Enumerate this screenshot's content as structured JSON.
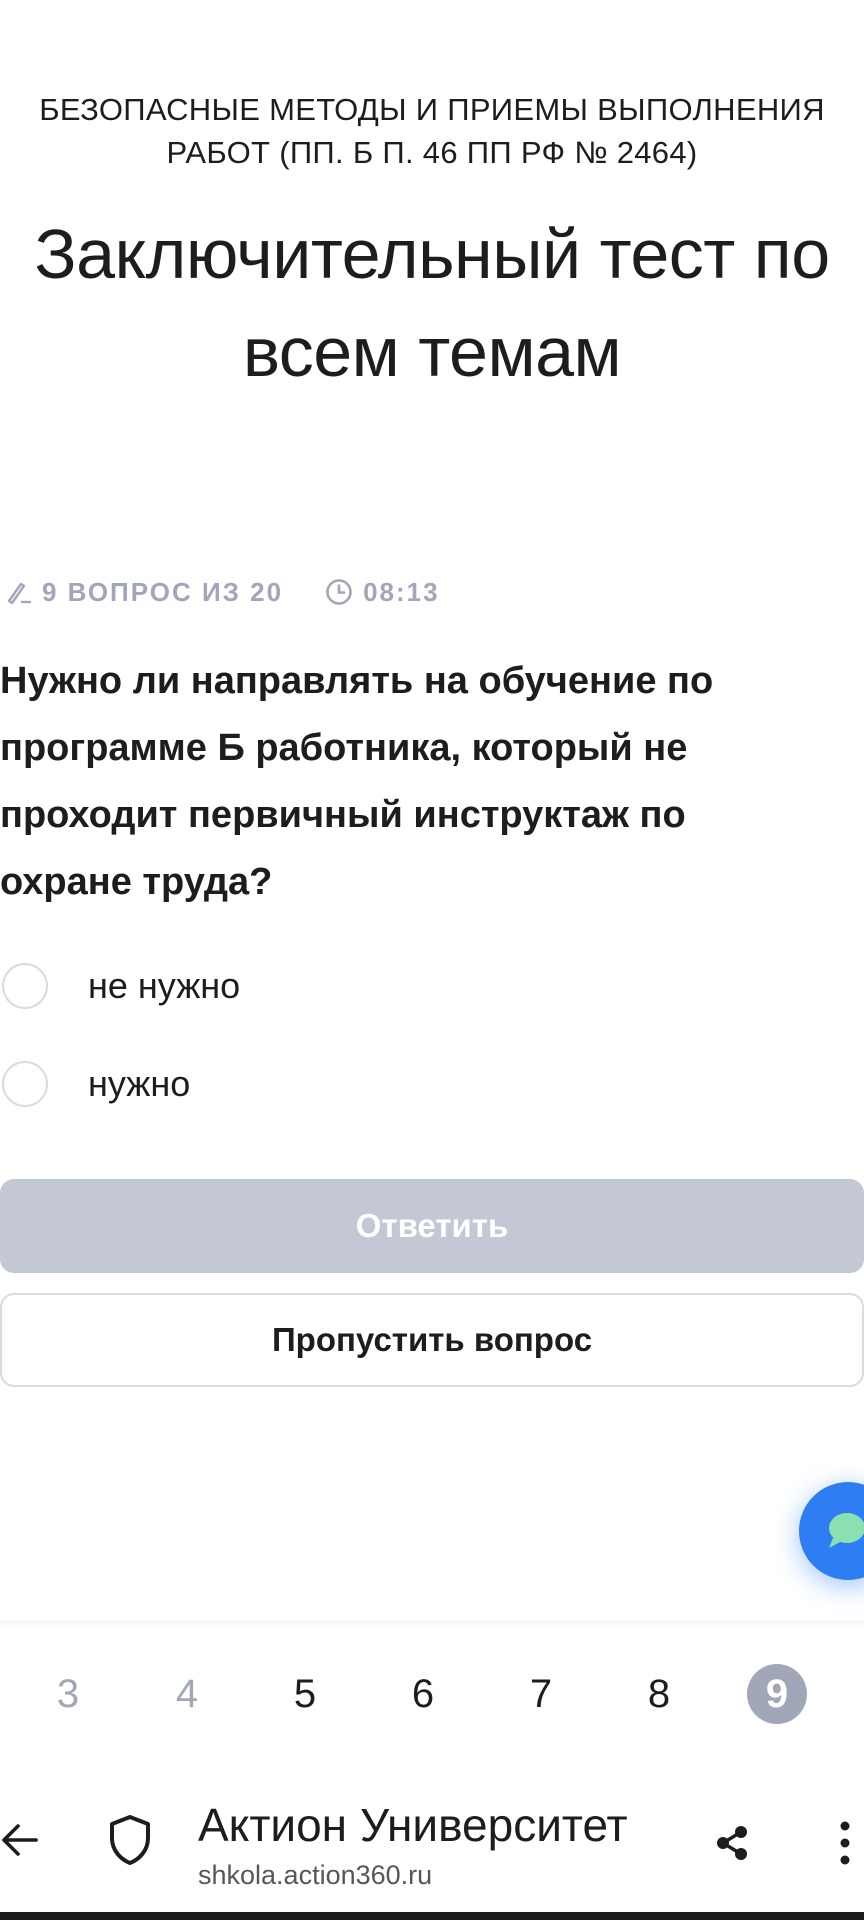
{
  "course": {
    "title": "БЕЗОПАСНЫЕ МЕТОДЫ И ПРИЕМЫ ВЫПОЛНЕНИЯ РАБОТ (ПП. Б П. 46 ПП РФ № 2464)"
  },
  "test": {
    "title": "Заключительный тест по всем темам"
  },
  "meta": {
    "progress": "9 ВОПРОС ИЗ 20",
    "timer": "08:13"
  },
  "question": {
    "text": "Нужно ли направлять на обучение по программе Б работника, который не проходит первичный инструктаж по охране труда?",
    "options": [
      {
        "label": "не нужно",
        "selected": false
      },
      {
        "label": "нужно",
        "selected": false
      }
    ]
  },
  "actions": {
    "answer_label": "Ответить",
    "skip_label": "Пропустить вопрос"
  },
  "pager": {
    "pages": [
      "3",
      "4",
      "5",
      "6",
      "7",
      "8",
      "9"
    ],
    "visited": [
      "3",
      "4"
    ],
    "current": "9"
  },
  "browser": {
    "site_title": "Актион Университет",
    "url": "shkola.action360.ru"
  },
  "colors": {
    "accent_blue": "#2f7df3",
    "muted": "#a1a7b8",
    "disabled_button": "#c4c8d5",
    "text": "#1d1d1f"
  },
  "icons": {
    "progress": "pencil-icon",
    "timer": "clock-icon",
    "chat": "chat-bubble-icon",
    "back": "back-arrow-icon",
    "security": "shield-icon",
    "share": "share-icon",
    "menu": "kebab-menu-icon"
  }
}
